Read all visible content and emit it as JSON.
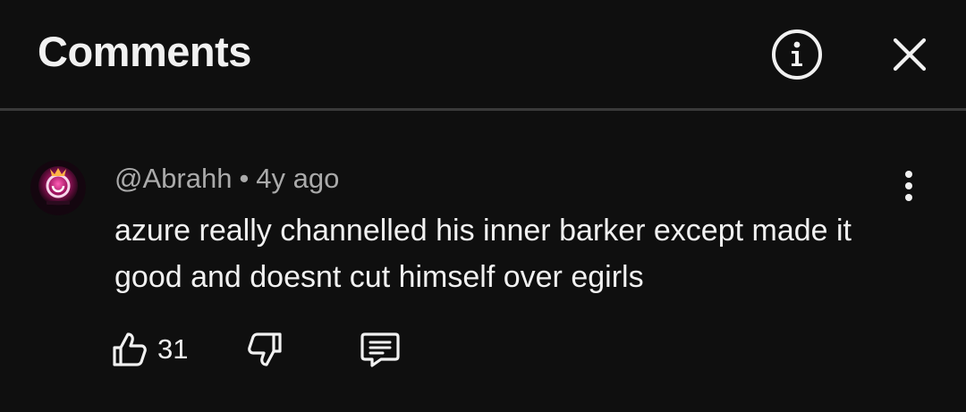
{
  "header": {
    "title": "Comments",
    "info_icon": "info-circle-icon",
    "close_icon": "close-icon"
  },
  "comment": {
    "author": "@Abrahh",
    "separator": "•",
    "time": "4y ago",
    "text": "azure really channelled his inner barker except made it good and doesnt cut himself over egirls",
    "avatar_icon": "avatar-icon",
    "more_icon": "more-vertical-icon",
    "likes": "31",
    "like_icon": "thumbs-up-icon",
    "dislike_icon": "thumbs-down-icon",
    "reply_icon": "reply-icon"
  },
  "colors": {
    "background": "#0f0f0f",
    "text_primary": "#f1f1f1",
    "text_secondary": "#aaaaaa",
    "divider": "#3a3a3a",
    "avatar_accent": "#c2187a"
  }
}
